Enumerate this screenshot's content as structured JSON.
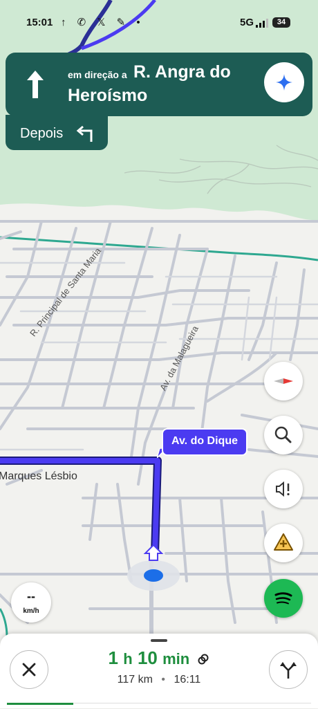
{
  "status_bar": {
    "time": "15:01",
    "app_icons": "↑ ✆ 𝕏 ✎ •",
    "network": "5G",
    "battery": "34"
  },
  "navigation": {
    "toward_label": "em direção a",
    "street_line1": "R. Angra do",
    "street_line2": "Heroísmo",
    "then_label": "Depois",
    "maneuver": "straight",
    "then_maneuver": "turn-left"
  },
  "map": {
    "street_labels": [
      "R. Principal de Santa Maria",
      "Av. da Malagueira",
      "Marques Lésbio"
    ],
    "route_callout": "Av. do Dique"
  },
  "speedometer": {
    "value": "--",
    "unit": "km/h"
  },
  "trip": {
    "hours": "1",
    "hours_unit": "h",
    "minutes": "10",
    "minutes_unit": "min",
    "distance": "117 km",
    "separator": "•",
    "arrival": "16:11"
  },
  "icons": {
    "compass": "compass-icon",
    "search": "search-icon",
    "sound": "volume-alert-icon",
    "report": "report-incident-icon",
    "spotify": "spotify-icon",
    "exit": "close-icon",
    "alternate_routes": "fork-icon",
    "gemini": "sparkle-icon"
  },
  "colors": {
    "banner": "#1d5c54",
    "route": "#4b3bf1",
    "eta": "#1e8e3e",
    "park": "#cfe9d3"
  }
}
